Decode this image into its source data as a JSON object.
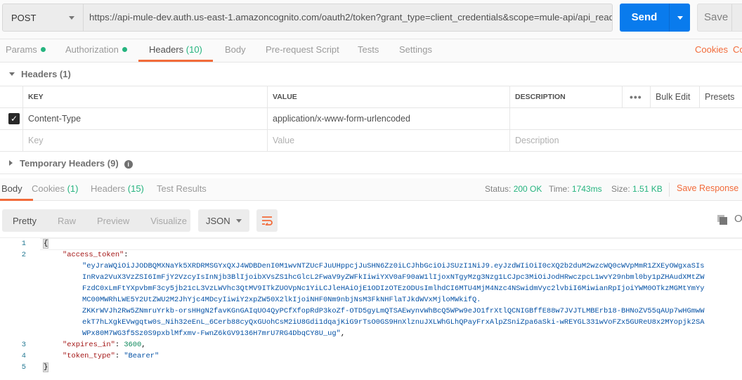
{
  "request": {
    "method": "POST",
    "url": "https://api-mule-dev.auth.us-east-1.amazoncognito.com/oauth2/token?grant_type=client_credentials&scope=mule-api/api_read",
    "send_label": "Send",
    "save_label": "Save"
  },
  "tabs": [
    {
      "label": "Params"
    },
    {
      "label": "Authorization"
    },
    {
      "label": "Headers",
      "count": "(10)"
    },
    {
      "label": "Body"
    },
    {
      "label": "Pre-request Script"
    },
    {
      "label": "Tests"
    },
    {
      "label": "Settings"
    }
  ],
  "links": {
    "cookies": "Cookies",
    "code": "Code"
  },
  "headers_section": {
    "title": "Headers (1)",
    "columns": [
      "KEY",
      "VALUE",
      "DESCRIPTION"
    ],
    "bulk_edit": "Bulk Edit",
    "presets": "Presets",
    "rows": [
      {
        "key": "Content-Type",
        "value": "application/x-www-form-urlencoded",
        "checked": true
      }
    ],
    "placeholders": {
      "key": "Key",
      "value": "Value",
      "description": "Description"
    }
  },
  "temp_headers": {
    "title": "Temporary Headers (9)"
  },
  "response": {
    "tabs": [
      {
        "label": "Body"
      },
      {
        "label": "Cookies",
        "count": "(1)"
      },
      {
        "label": "Headers",
        "count": "(15)"
      },
      {
        "label": "Test Results"
      }
    ],
    "status_label": "Status:",
    "status": "200 OK",
    "time_label": "Time:",
    "time": "1743ms",
    "size_label": "Size:",
    "size": "1.51 KB",
    "save_response": "Save Response",
    "views": [
      "Pretty",
      "Raw",
      "Preview",
      "Visualize"
    ],
    "format": "JSON"
  },
  "code": {
    "line_numbers": [
      "1",
      "2",
      "3",
      "4",
      "5"
    ],
    "open": "{",
    "close": "}",
    "access_token_key": "\"access_token\"",
    "token_lines": [
      "\"eyJraWQiOiJJODBQMXNaYk5XRDRMSGYxQXJ4WDBDenI0M1wvNTZUcFJuUHppcjJuSHN6Zz0iLCJhbGciOiJSUzI1NiJ9.eyJzdWIiOiI0cXQ2b2duM2wzcWQ0cWVpMmR1ZXEyOWgxaSIs",
      "InRva2VuX3VzZSI6ImFjY2VzcyIsInNjb3BlIjoibXVsZS1hcGlcL2FwaV9yZWFkIiwiYXV0aF90aW1lIjoxNTgyMzg3Nzg1LCJpc3MiOiJodHRwczpcL1wvY29nbml0by1pZHAudXMtZW",
      "FzdC0xLmFtYXpvbmF3cy5jb21cL3VzLWVhc3QtMV9ITkZUOVpNc1YiLCJleHAiOjE1ODIzOTEzODUsImlhdCI6MTU4MjM4Nzc4NSwidmVyc2lvbiI6MiwianRpIjoiYWM0OTkzMGMtYmYy",
      "MC00MWRhLWE5Y2UtZWU2M2JhYjc4MDcyIiwiY2xpZW50X2lkIjoiNHF0Nm9nbjNsM3FkNHFlaTJkdWVxMjloMWkifQ.",
      "ZKKrWVJh2Rw5ZNmruYrkb-orsHHgN2favKGnGAIqUO4QyPCfXfopRdP3koZf-OTD5gyLmQTSAEwynvWhBcQ5WPw9eJO1frXtlQCNIGBffE88w7JVJTLMBErb18-BHNoZV55qAUp7wHGmwW",
      "ekT7hLXgkEVwgqtw0s_Nih32eEnL_6Cerb88cyQxGUohCsM2iU8Gdi1dqajKiG9rTsO0GS9HnXlznuJXLWhGLhQPayFrxAlpZSniZpa6aSki-wREYGL331wVoFZx5GUReU8x2MYopjk2SA",
      "WPx80M7WG3f5Sz0S9pxblMfxmv-FwnZ6kGV9136H7mrU7RG4DbqCY8U_ug\""
    ],
    "expires_key": "\"expires_in\"",
    "expires_value": "3600",
    "token_type_key": "\"token_type\"",
    "token_type_value": "\"Bearer\""
  }
}
